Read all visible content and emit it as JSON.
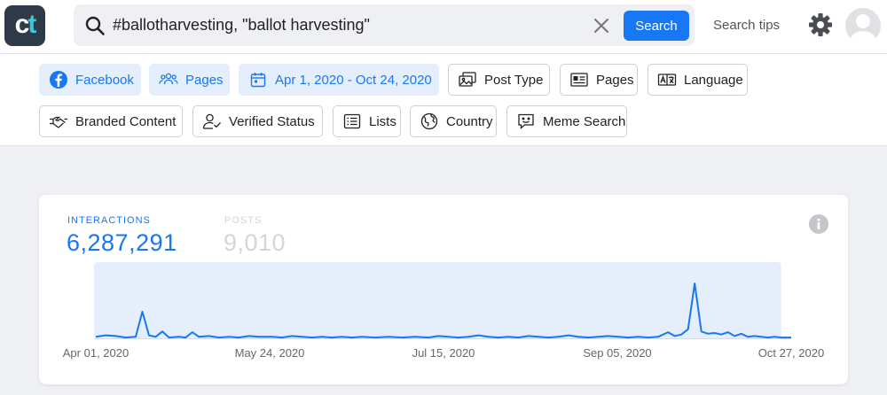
{
  "header": {
    "logo_c": "c",
    "logo_t": "t",
    "search": {
      "value": "#ballotharvesting, \"ballot harvesting\""
    },
    "search_button": "Search",
    "search_tips": "Search tips"
  },
  "filters": [
    {
      "label": "Facebook",
      "icon": "facebook-icon",
      "active": true
    },
    {
      "label": "Pages",
      "icon": "people-icon",
      "active": true
    },
    {
      "label": "Apr 1, 2020 - Oct 24, 2020",
      "icon": "calendar-icon",
      "active": true
    },
    {
      "label": "Post Type",
      "icon": "images-icon",
      "active": false
    },
    {
      "label": "Pages",
      "icon": "page-icon",
      "active": false
    },
    {
      "label": "Language",
      "icon": "language-icon",
      "active": false
    },
    {
      "label": "Branded Content",
      "icon": "handshake-icon",
      "active": false
    },
    {
      "label": "Verified Status",
      "icon": "user-check-icon",
      "active": false
    },
    {
      "label": "Lists",
      "icon": "list-icon",
      "active": false
    },
    {
      "label": "Country",
      "icon": "globe-icon",
      "active": false
    },
    {
      "label": "Meme Search",
      "icon": "meme-icon",
      "active": false
    }
  ],
  "summary": {
    "interactions_label": "INTERACTIONS",
    "interactions_value": "6,287,291",
    "posts_label": "POSTS",
    "posts_value": "9,010"
  },
  "colors": {
    "accent": "#1877f2",
    "muted": "#d8dadd",
    "range_fill": "#e4effb"
  },
  "chart_data": {
    "type": "area",
    "x_ticks": [
      "Apr 01, 2020",
      "May 24, 2020",
      "Jul 15, 2020",
      "Sep 05, 2020",
      "Oct 27, 2020"
    ],
    "x_range": [
      "2020-04-01",
      "2020-10-27"
    ],
    "selected_range": [
      "2020-04-01",
      "2020-10-24"
    ],
    "grid": false,
    "points": [
      [
        "2020-04-01",
        0.02
      ],
      [
        "2020-04-04",
        0.04
      ],
      [
        "2020-04-07",
        0.03
      ],
      [
        "2020-04-10",
        0.01
      ],
      [
        "2020-04-13",
        0.02
      ],
      [
        "2020-04-15",
        0.35
      ],
      [
        "2020-04-17",
        0.04
      ],
      [
        "2020-04-19",
        0.02
      ],
      [
        "2020-04-21",
        0.09
      ],
      [
        "2020-04-23",
        0.01
      ],
      [
        "2020-04-26",
        0.02
      ],
      [
        "2020-04-28",
        0.01
      ],
      [
        "2020-04-30",
        0.08
      ],
      [
        "2020-05-02",
        0.02
      ],
      [
        "2020-05-05",
        0.03
      ],
      [
        "2020-05-08",
        0.01
      ],
      [
        "2020-05-11",
        0.02
      ],
      [
        "2020-05-14",
        0.01
      ],
      [
        "2020-05-17",
        0.03
      ],
      [
        "2020-05-20",
        0.02
      ],
      [
        "2020-05-24",
        0.02
      ],
      [
        "2020-05-27",
        0.01
      ],
      [
        "2020-05-30",
        0.03
      ],
      [
        "2020-06-02",
        0.02
      ],
      [
        "2020-06-05",
        0.01
      ],
      [
        "2020-06-08",
        0.02
      ],
      [
        "2020-06-11",
        0.01
      ],
      [
        "2020-06-14",
        0.02
      ],
      [
        "2020-06-17",
        0.01
      ],
      [
        "2020-06-20",
        0.02
      ],
      [
        "2020-06-24",
        0.01
      ],
      [
        "2020-06-28",
        0.02
      ],
      [
        "2020-07-02",
        0.01
      ],
      [
        "2020-07-06",
        0.02
      ],
      [
        "2020-07-10",
        0.01
      ],
      [
        "2020-07-13",
        0.03
      ],
      [
        "2020-07-16",
        0.02
      ],
      [
        "2020-07-19",
        0.01
      ],
      [
        "2020-07-22",
        0.02
      ],
      [
        "2020-07-25",
        0.04
      ],
      [
        "2020-07-28",
        0.02
      ],
      [
        "2020-07-31",
        0.01
      ],
      [
        "2020-08-03",
        0.02
      ],
      [
        "2020-08-06",
        0.01
      ],
      [
        "2020-08-09",
        0.03
      ],
      [
        "2020-08-12",
        0.02
      ],
      [
        "2020-08-15",
        0.01
      ],
      [
        "2020-08-18",
        0.02
      ],
      [
        "2020-08-21",
        0.04
      ],
      [
        "2020-08-24",
        0.02
      ],
      [
        "2020-08-27",
        0.01
      ],
      [
        "2020-08-30",
        0.02
      ],
      [
        "2020-09-02",
        0.03
      ],
      [
        "2020-09-05",
        0.02
      ],
      [
        "2020-09-08",
        0.01
      ],
      [
        "2020-09-11",
        0.02
      ],
      [
        "2020-09-14",
        0.01
      ],
      [
        "2020-09-17",
        0.02
      ],
      [
        "2020-09-20",
        0.08
      ],
      [
        "2020-09-22",
        0.03
      ],
      [
        "2020-09-24",
        0.05
      ],
      [
        "2020-09-26",
        0.12
      ],
      [
        "2020-09-28",
        0.72
      ],
      [
        "2020-09-30",
        0.09
      ],
      [
        "2020-10-02",
        0.06
      ],
      [
        "2020-10-04",
        0.07
      ],
      [
        "2020-10-06",
        0.05
      ],
      [
        "2020-10-08",
        0.08
      ],
      [
        "2020-10-10",
        0.03
      ],
      [
        "2020-10-12",
        0.06
      ],
      [
        "2020-10-14",
        0.02
      ],
      [
        "2020-10-16",
        0.03
      ],
      [
        "2020-10-18",
        0.02
      ],
      [
        "2020-10-20",
        0.01
      ],
      [
        "2020-10-22",
        0.02
      ],
      [
        "2020-10-24",
        0.01
      ],
      [
        "2020-10-27",
        0.01
      ]
    ]
  }
}
